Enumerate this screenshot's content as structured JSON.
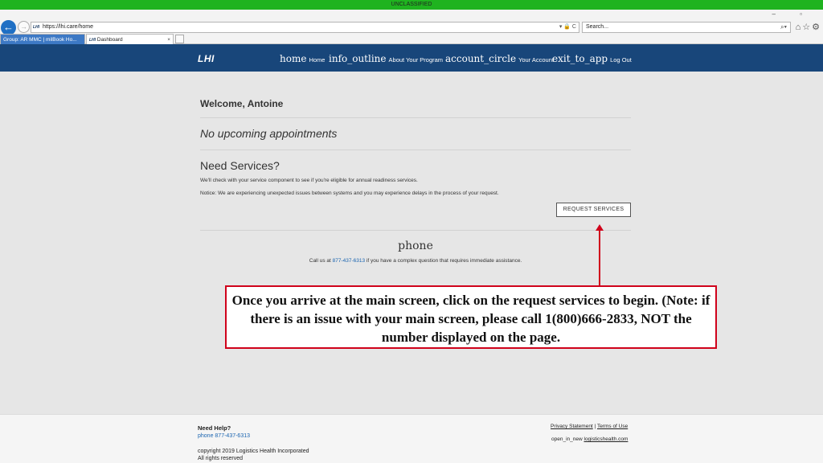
{
  "classification": "UNCLASSIFIED",
  "browser": {
    "url": "https://lhi.care/home",
    "favicon_text": "LHI",
    "address_tools": "▾ 🔒 C",
    "search_placeholder": "Search...",
    "search_icon": "⌕▾",
    "window_controls": "–  ▫",
    "toolbar_icons": "⌂☆⚙",
    "tabs": [
      {
        "label": "Group: AR MMC | milBook Ho..."
      },
      {
        "label": "Dashboard",
        "icon_text": "LHI",
        "close": "×"
      }
    ]
  },
  "header": {
    "logo": "LHI",
    "nav": [
      {
        "icon": "home",
        "label": "Home"
      },
      {
        "icon": "info_outline",
        "label": "About Your Program"
      },
      {
        "icon": "account_circle",
        "label": "Your Account"
      },
      {
        "icon": "exit_to_app",
        "label": "Log Out"
      }
    ]
  },
  "main": {
    "welcome": "Welcome, Antoine",
    "appointments": "No upcoming appointments",
    "services_title": "Need Services?",
    "services_text": "We'll check with your service component to see if you're eligible for annual readiness services.",
    "notice": "Notice: We are experiencing unexpected issues between systems and you may experience delays in the process of your request.",
    "request_button": "REQUEST SERVICES",
    "phone_icon": "phone",
    "call_prefix": "Call us at ",
    "call_number": "877-437-6313",
    "call_suffix": " if you have a complex question that requires immediate assistance."
  },
  "callout": {
    "text": "Once you arrive at the main screen, click on the request services to begin. (Note: if there is an issue with your main screen, please call 1(800)666-2833, NOT the number displayed on the page.",
    "color": "#d0021b"
  },
  "footer": {
    "need_help": "Need Help?",
    "phone": "phone 877-437-6313",
    "copyright": "copyright 2019 Logistics Health Incorporated",
    "rights": "All rights reserved",
    "privacy": "Privacy Statement",
    "separator": " | ",
    "terms": "Terms of Use",
    "ext_icon": "open_in_new",
    "ext_link": "logisticshealth.com"
  },
  "colors": {
    "header": "#18467a",
    "classbar": "#1fb31f",
    "link": "#1a64b0"
  }
}
